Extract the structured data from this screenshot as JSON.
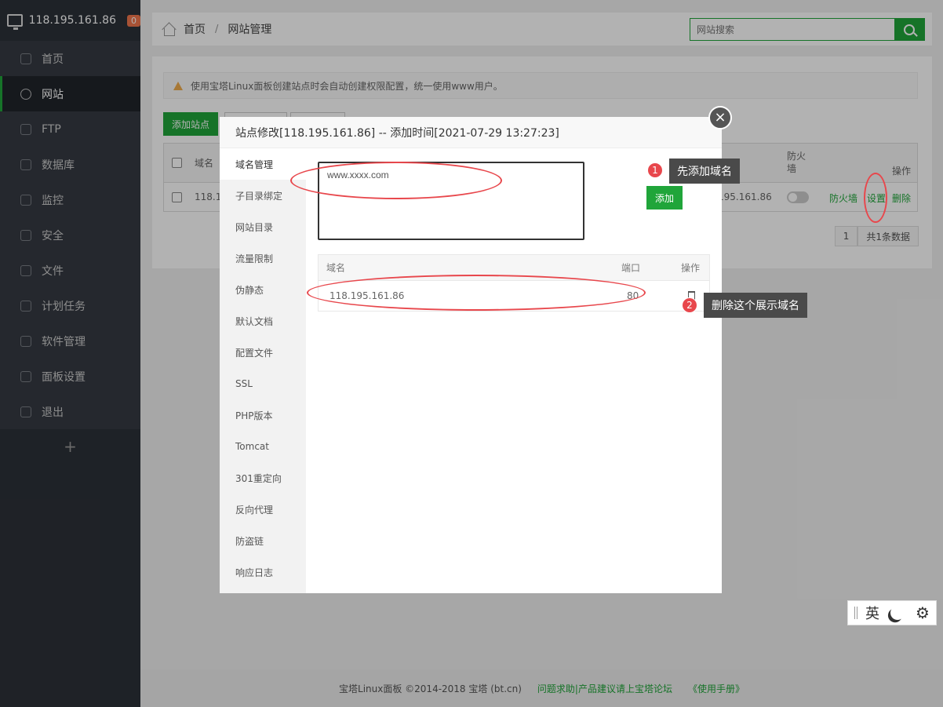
{
  "sidebar": {
    "server": "118.195.161.86",
    "badge": "0",
    "items": [
      {
        "label": "首页"
      },
      {
        "label": "网站"
      },
      {
        "label": "FTP"
      },
      {
        "label": "数据库"
      },
      {
        "label": "监控"
      },
      {
        "label": "安全"
      },
      {
        "label": "文件"
      },
      {
        "label": "计划任务"
      },
      {
        "label": "软件管理"
      },
      {
        "label": "面板设置"
      },
      {
        "label": "退出"
      }
    ],
    "plus": "+"
  },
  "breadcrumb": {
    "home": "首页",
    "sep": "/",
    "current": "网站管理"
  },
  "search": {
    "placeholder": "网站搜索"
  },
  "notice": "使用宝塔Linux面板创建站点时会自动创建权限配置，统一使用www用户。",
  "site_list": {
    "add_site": "添加站点",
    "col_domain": "域名",
    "col_firewall": "防火墙",
    "col_ops": "操作",
    "row_domain": "118.1",
    "row_ip": "195.161.86",
    "firewall_link": "防火墙",
    "settings_link": "设置",
    "delete_link": "删除",
    "page": "1",
    "total": "共1条数据"
  },
  "modal": {
    "title": "站点修改[118.195.161.86] -- 添加时间[2021-07-29 13:27:23]",
    "close": "×",
    "tabs": [
      "域名管理",
      "子目录绑定",
      "网站目录",
      "流量限制",
      "伪静态",
      "默认文档",
      "配置文件",
      "SSL",
      "PHP版本",
      "Tomcat",
      "301重定向",
      "反向代理",
      "防盗链",
      "响应日志"
    ],
    "textarea_value": "www.xxxx.com",
    "add_button": "添加",
    "table": {
      "col_domain": "域名",
      "col_port": "端口",
      "col_ops": "操作",
      "rows": [
        {
          "domain": "118.195.161.86",
          "port": "80"
        }
      ]
    }
  },
  "annotations": {
    "step1_num": "1",
    "step1_text": "先添加域名",
    "step2_num": "2",
    "step2_text": "删除这个展示域名"
  },
  "footer": {
    "copyright": "宝塔Linux面板 ©2014-2018 宝塔 (bt.cn)",
    "help": "问题求助|产品建议请上宝塔论坛",
    "manual": "《使用手册》"
  },
  "ime": {
    "lang": "英",
    "gear": "⚙"
  }
}
